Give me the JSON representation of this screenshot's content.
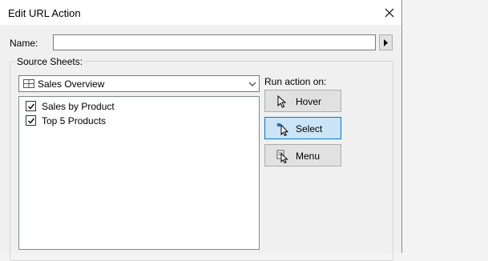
{
  "window": {
    "title": "Edit URL Action"
  },
  "name_field": {
    "label": "Name:",
    "value": ""
  },
  "source": {
    "group_label": "Source Sheets:",
    "selected_sheet": "Sales Overview",
    "sheets": [
      {
        "label": "Sales by Product",
        "checked": true
      },
      {
        "label": "Top 5 Products",
        "checked": true
      }
    ]
  },
  "run_action": {
    "label": "Run action on:",
    "options": [
      {
        "label": "Hover",
        "icon": "hover-cursor-icon",
        "selected": false
      },
      {
        "label": "Select",
        "icon": "select-cursor-icon",
        "selected": true
      },
      {
        "label": "Menu",
        "icon": "menu-cursor-icon",
        "selected": false
      }
    ]
  },
  "colors": {
    "selected_border": "#0078d7",
    "selected_fill": "#cce4f7"
  }
}
